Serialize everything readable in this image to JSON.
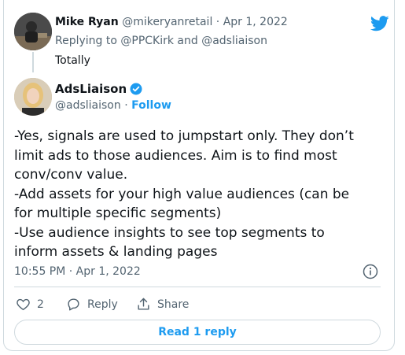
{
  "parent": {
    "name": "Mike Ryan",
    "handle_date": "@mikeryanretail · Apr 1, 2022",
    "reply_to": "Replying to @PPCKirk and @adsliaison",
    "text": "Totally"
  },
  "tweet": {
    "name": "AdsLiaison",
    "handle": "@adsliaison",
    "separator": " · ",
    "follow": "Follow",
    "lines": [
      "-Yes, signals are used to jumpstart only. They don’t",
      "limit ads to those audiences. Aim is to find most",
      "conv/conv value.",
      "-Add assets for your high value audiences (can be",
      "for multiple specific segments)",
      "-Use audience insights to see top segments to",
      "inform assets & landing pages"
    ],
    "timestamp": "10:55 PM · Apr 1, 2022"
  },
  "actions": {
    "like_count": "2",
    "reply_label": "Reply",
    "share_label": "Share"
  },
  "read_reply": "Read 1 reply",
  "colors": {
    "accent": "#1d9bf0",
    "muted": "#536471",
    "border": "#cfd9de"
  }
}
